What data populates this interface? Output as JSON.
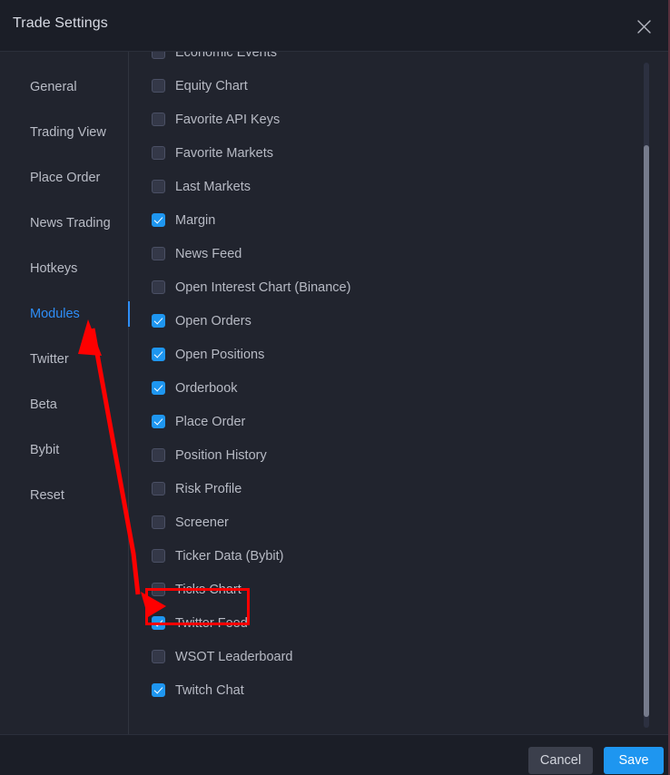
{
  "window": {
    "title": "Trade Settings",
    "close_icon": "close-icon"
  },
  "colors": {
    "accent_blue": "#1e96f0",
    "active_nav_blue": "#2e8ef7",
    "annotation_red": "#fe0000",
    "panel_bg": "#21242e",
    "header_bg": "#1b1e27",
    "checkbox_off_bg": "#343848",
    "cancel_btn_bg": "#3b3f4c"
  },
  "sidebar": {
    "items": [
      {
        "label": "General",
        "active": false
      },
      {
        "label": "Trading View",
        "active": false
      },
      {
        "label": "Place Order",
        "active": false
      },
      {
        "label": "News Trading",
        "active": false
      },
      {
        "label": "Hotkeys",
        "active": false
      },
      {
        "label": "Modules",
        "active": true
      },
      {
        "label": "Twitter",
        "active": false
      },
      {
        "label": "Beta",
        "active": false
      },
      {
        "label": "Bybit",
        "active": false
      },
      {
        "label": "Reset",
        "active": false
      }
    ]
  },
  "modules": {
    "items": [
      {
        "label": "Economic Events",
        "checked": false
      },
      {
        "label": "Equity Chart",
        "checked": false
      },
      {
        "label": "Favorite API Keys",
        "checked": false
      },
      {
        "label": "Favorite Markets",
        "checked": false
      },
      {
        "label": "Last Markets",
        "checked": false
      },
      {
        "label": "Margin",
        "checked": true
      },
      {
        "label": "News Feed",
        "checked": false
      },
      {
        "label": "Open Interest Chart (Binance)",
        "checked": false
      },
      {
        "label": "Open Orders",
        "checked": true
      },
      {
        "label": "Open Positions",
        "checked": true
      },
      {
        "label": "Orderbook",
        "checked": true
      },
      {
        "label": "Place Order",
        "checked": true
      },
      {
        "label": "Position History",
        "checked": false
      },
      {
        "label": "Risk Profile",
        "checked": false
      },
      {
        "label": "Screener",
        "checked": false
      },
      {
        "label": "Ticker Data (Bybit)",
        "checked": false
      },
      {
        "label": "Ticks Chart",
        "checked": false
      },
      {
        "label": "Twitter Feed",
        "checked": true
      },
      {
        "label": "WSOT Leaderboard",
        "checked": false
      },
      {
        "label": "Twitch Chat",
        "checked": true
      }
    ]
  },
  "footer": {
    "cancel_label": "Cancel",
    "save_label": "Save"
  },
  "annotations": {
    "arrow_name": "red-double-arrow",
    "highlight_name": "red-highlight-box",
    "highlight_target": "Ticks Chart"
  }
}
